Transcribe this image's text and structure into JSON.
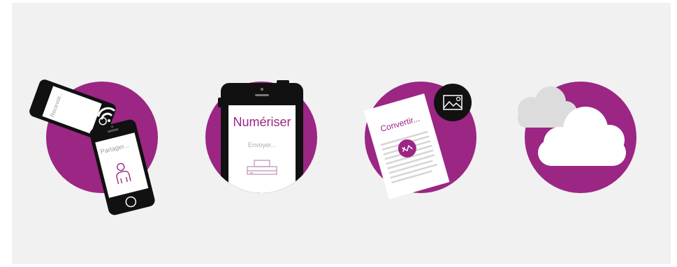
{
  "colors": {
    "background": "#f1f1f1",
    "accent": "#9b2684",
    "phone_body": "#111111",
    "screen": "#ffffff",
    "muted": "#c9a5c0",
    "cloud_light": "#dcdcdc"
  },
  "illustrations": {
    "share": {
      "back_phone_text": "Recevoir...",
      "front_phone_text": "Partager...",
      "icons": [
        "wifi-icon",
        "person-icon"
      ]
    },
    "scan": {
      "title": "Numériser",
      "subtitle": "Envoyer...",
      "icons": [
        "scanner-icon"
      ]
    },
    "convert": {
      "title": "Convertir...",
      "icons": [
        "image-icon",
        "convert-arrows-icon"
      ]
    },
    "cloud": {
      "icons": [
        "cloud-icon"
      ]
    }
  }
}
